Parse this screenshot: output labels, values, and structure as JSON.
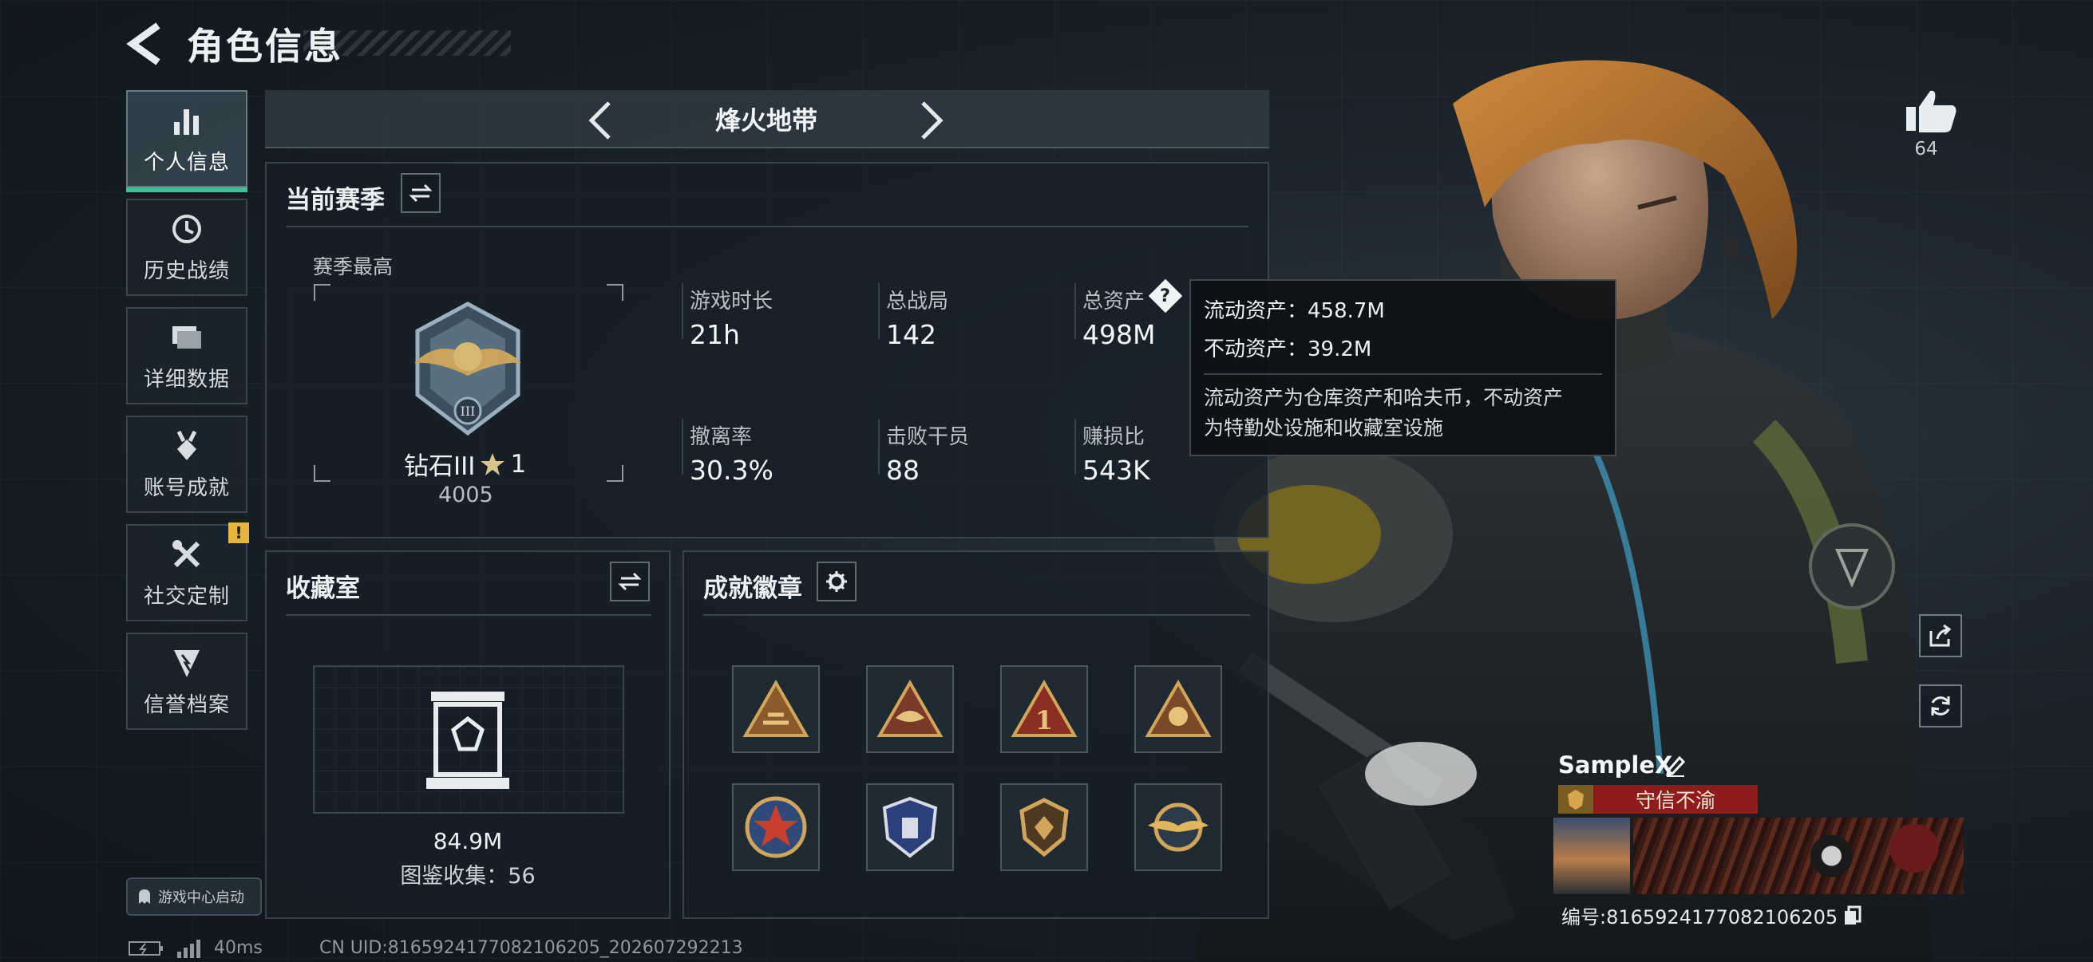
{
  "header": {
    "title": "角色信息"
  },
  "nav": {
    "items": [
      {
        "label": "个人信息",
        "icon": "bar-chart-icon"
      },
      {
        "label": "历史战绩",
        "icon": "history-clock-icon"
      },
      {
        "label": "详细数据",
        "icon": "folder-icon"
      },
      {
        "label": "账号成就",
        "icon": "medal-icon"
      },
      {
        "label": "社交定制",
        "icon": "tools-icon",
        "badge": "!"
      },
      {
        "label": "信誉档案",
        "icon": "credit-shield-icon"
      }
    ],
    "launch_label": "游戏中心启动"
  },
  "mode": {
    "name": "烽火地带"
  },
  "season": {
    "title": "当前赛季",
    "best_label": "赛季最高",
    "rank_name": "钻石III",
    "rank_stars": "1",
    "rank_points": "4005",
    "stats": [
      {
        "label": "游戏时长",
        "value": "21h"
      },
      {
        "label": "总战局",
        "value": "142"
      },
      {
        "label": "总资产",
        "value": "498M"
      },
      {
        "label": "撤离率",
        "value": "30.3%"
      },
      {
        "label": "击败干员",
        "value": "88"
      },
      {
        "label": "赚损比",
        "value": "543K"
      }
    ]
  },
  "tooltip": {
    "liquid": "流动资产：458.7M",
    "fixed": "不动资产：39.2M",
    "desc_line1": "流动资产为仓库资产和哈夫币，不动资产",
    "desc_line2": "为特勤处设施和收藏室设施"
  },
  "collection": {
    "title": "收藏室",
    "value": "84.9M",
    "collected": "图鉴收集：56"
  },
  "achievements": {
    "title": "成就徽章",
    "badges": [
      "triangle-badge",
      "triangle-badge",
      "triangle-number-badge",
      "triangle-badge",
      "star-round-badge",
      "shield-badge",
      "hex-shield-badge",
      "wings-badge"
    ]
  },
  "likes": {
    "count": "64"
  },
  "player": {
    "name": "SampleX",
    "title": "守信不渝",
    "uid": "编号:8165924177082106205"
  },
  "status": {
    "ping": "40ms",
    "cn_uid": "CN UID:8165924177082106205_202607292213"
  },
  "colors": {
    "accent": "#3fc29a",
    "warning": "#e8b536",
    "title_red": "#8e1c1c"
  }
}
